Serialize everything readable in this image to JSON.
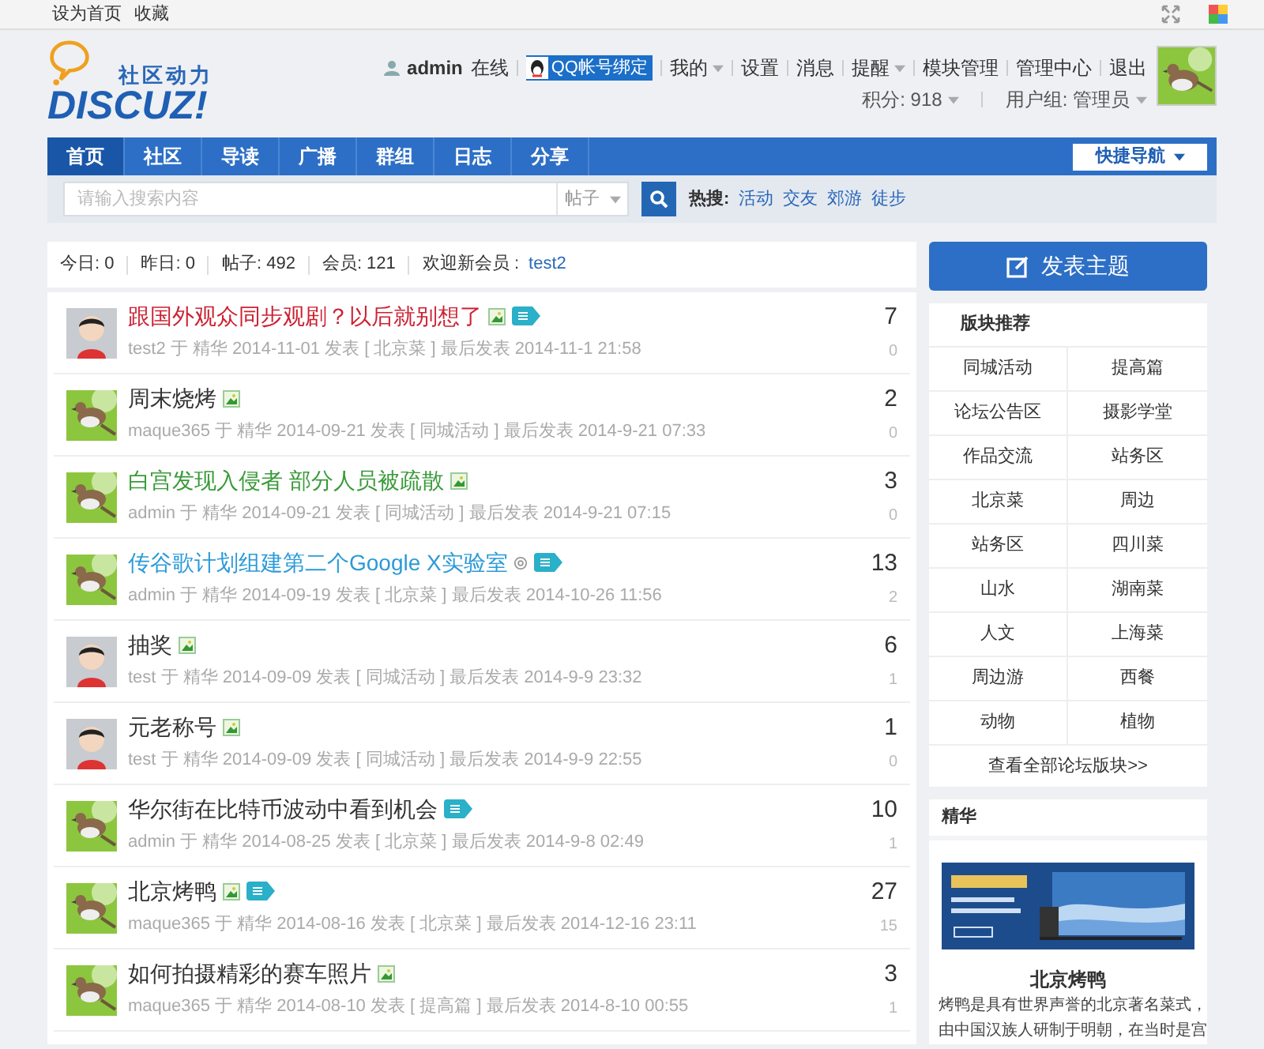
{
  "topbar": {
    "links": [
      "设为首页",
      "收藏"
    ]
  },
  "logo": {
    "tagline": "社区动力",
    "wordmark": "DISCUZ!"
  },
  "user": {
    "name": "admin",
    "status": "在线",
    "qq_button": "QQ帐号绑定",
    "links": [
      {
        "label": "我的",
        "dropdown": true
      },
      {
        "label": "设置",
        "dropdown": false
      },
      {
        "label": "消息",
        "dropdown": false
      },
      {
        "label": "提醒",
        "dropdown": true
      },
      {
        "label": "模块管理",
        "dropdown": false
      },
      {
        "label": "管理中心",
        "dropdown": false
      },
      {
        "label": "退出",
        "dropdown": false
      }
    ],
    "info": [
      {
        "label": "积分: 918"
      },
      {
        "label": "用户组: 管理员"
      }
    ]
  },
  "nav": {
    "tabs": [
      {
        "label": "首页",
        "selected": true
      },
      {
        "label": "社区",
        "selected": false
      },
      {
        "label": "导读",
        "selected": false
      },
      {
        "label": "广播",
        "selected": false
      },
      {
        "label": "群组",
        "selected": false
      },
      {
        "label": "日志",
        "selected": false
      },
      {
        "label": "分享",
        "selected": false
      }
    ],
    "quick_nav": "快捷导航"
  },
  "search": {
    "placeholder": "请输入搜索内容",
    "scope": "帖子",
    "hot_label": "热搜:",
    "hot": [
      "活动",
      "交友",
      "郊游",
      "徒步"
    ]
  },
  "stats": [
    {
      "text": "今日: 0"
    },
    {
      "text": "昨日: 0"
    },
    {
      "text": "帖子: 492"
    },
    {
      "text": "会员: 121"
    },
    {
      "text": "欢迎新会员 :",
      "link": "test2"
    }
  ],
  "threads": [
    {
      "title": "跟国外观众同步观剧？以后就别想了",
      "color": "#cc2233",
      "kind": "person",
      "image": true,
      "mention": false,
      "digest": true,
      "meta": "test2 于 精华 2014-11-01 发表 [ 北京菜 ] 最后发表 2014-11-1 21:58",
      "replies": "7",
      "views": "0"
    },
    {
      "title": "周末烧烤",
      "color": "#333333",
      "kind": "bird",
      "image": true,
      "mention": false,
      "digest": false,
      "meta": "maque365 于 精华 2014-09-21 发表 [ 同城活动 ] 最后发表 2014-9-21 07:33",
      "replies": "2",
      "views": "0"
    },
    {
      "title": "白宫发现入侵者 部分人员被疏散",
      "color": "#3a9a3a",
      "kind": "bird",
      "image": true,
      "mention": false,
      "digest": false,
      "meta": "admin 于 精华 2014-09-21 发表 [ 同城活动 ] 最后发表 2014-9-21 07:15",
      "replies": "3",
      "views": "0"
    },
    {
      "title": "传谷歌计划组建第二个Google X实验室",
      "color": "#2b9ad8",
      "kind": "bird",
      "image": false,
      "mention": true,
      "digest": true,
      "meta": "admin 于 精华 2014-09-19 发表 [ 北京菜 ] 最后发表 2014-10-26 11:56",
      "replies": "13",
      "views": "2"
    },
    {
      "title": "抽奖",
      "color": "#333333",
      "kind": "person",
      "image": true,
      "mention": false,
      "digest": false,
      "meta": "test 于 精华 2014-09-09 发表 [ 同城活动 ] 最后发表 2014-9-9 23:32",
      "replies": "6",
      "views": "1"
    },
    {
      "title": "元老称号",
      "color": "#333333",
      "kind": "person",
      "image": true,
      "mention": false,
      "digest": false,
      "meta": "test 于 精华 2014-09-09 发表 [ 同城活动 ] 最后发表 2014-9-9 22:55",
      "replies": "1",
      "views": "0"
    },
    {
      "title": "华尔街在比特币波动中看到机会",
      "color": "#333333",
      "kind": "bird",
      "image": false,
      "mention": false,
      "digest": true,
      "meta": "admin 于 精华 2014-08-25 发表 [ 北京菜 ] 最后发表 2014-9-8 02:49",
      "replies": "10",
      "views": "1"
    },
    {
      "title": "北京烤鸭",
      "color": "#333333",
      "kind": "bird",
      "image": true,
      "mention": false,
      "digest": true,
      "meta": "maque365 于 精华 2014-08-16 发表 [ 北京菜 ] 最后发表 2014-12-16 23:11",
      "replies": "27",
      "views": "15"
    },
    {
      "title": "如何拍摄精彩的赛车照片",
      "color": "#333333",
      "kind": "bird",
      "image": true,
      "mention": false,
      "digest": false,
      "meta": "maque365 于 精华 2014-08-10 发表 [ 提高篇 ] 最后发表 2014-8-10 00:55",
      "replies": "3",
      "views": "1"
    }
  ],
  "post_button": "发表主题",
  "recommend": {
    "title": "版块推荐",
    "forums": [
      "同城活动",
      "提高篇",
      "论坛公告区",
      "摄影学堂",
      "作品交流",
      "站务区",
      "北京菜",
      "周边",
      "站务区",
      "四川菜",
      "山水",
      "湖南菜",
      "人文",
      "上海菜",
      "周边游",
      "西餐",
      "动物",
      "植物"
    ],
    "more": "查看全部论坛版块>>"
  },
  "featured": {
    "title": "精华",
    "caption": "北京烤鸭",
    "lines": [
      "烤鸭是具有世界声誉的北京著名菜式，",
      "由中国汉族人研制于明朝，在当时是宫"
    ]
  }
}
